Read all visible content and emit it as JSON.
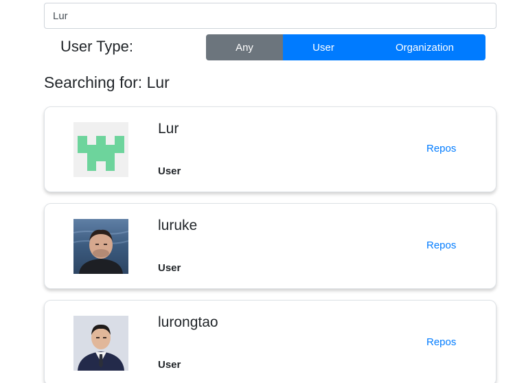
{
  "search": {
    "value": "Lur"
  },
  "filter": {
    "label": "User Type:",
    "options": [
      "Any",
      "User",
      "Organization"
    ],
    "selected": "Any",
    "colors": {
      "selected": "#6c757d",
      "unselected": "#007bff"
    }
  },
  "results_heading": "Searching for: Lur",
  "results": [
    {
      "username": "Lur",
      "type": "User",
      "repos_label": "Repos",
      "avatar": "identicon-green"
    },
    {
      "username": "luruke",
      "type": "User",
      "repos_label": "Repos",
      "avatar": "photo-man-water"
    },
    {
      "username": "lurongtao",
      "type": "User",
      "repos_label": "Repos",
      "avatar": "photo-man-suit"
    }
  ],
  "colors": {
    "link": "#007bff",
    "identicon": "#6dd49c"
  }
}
